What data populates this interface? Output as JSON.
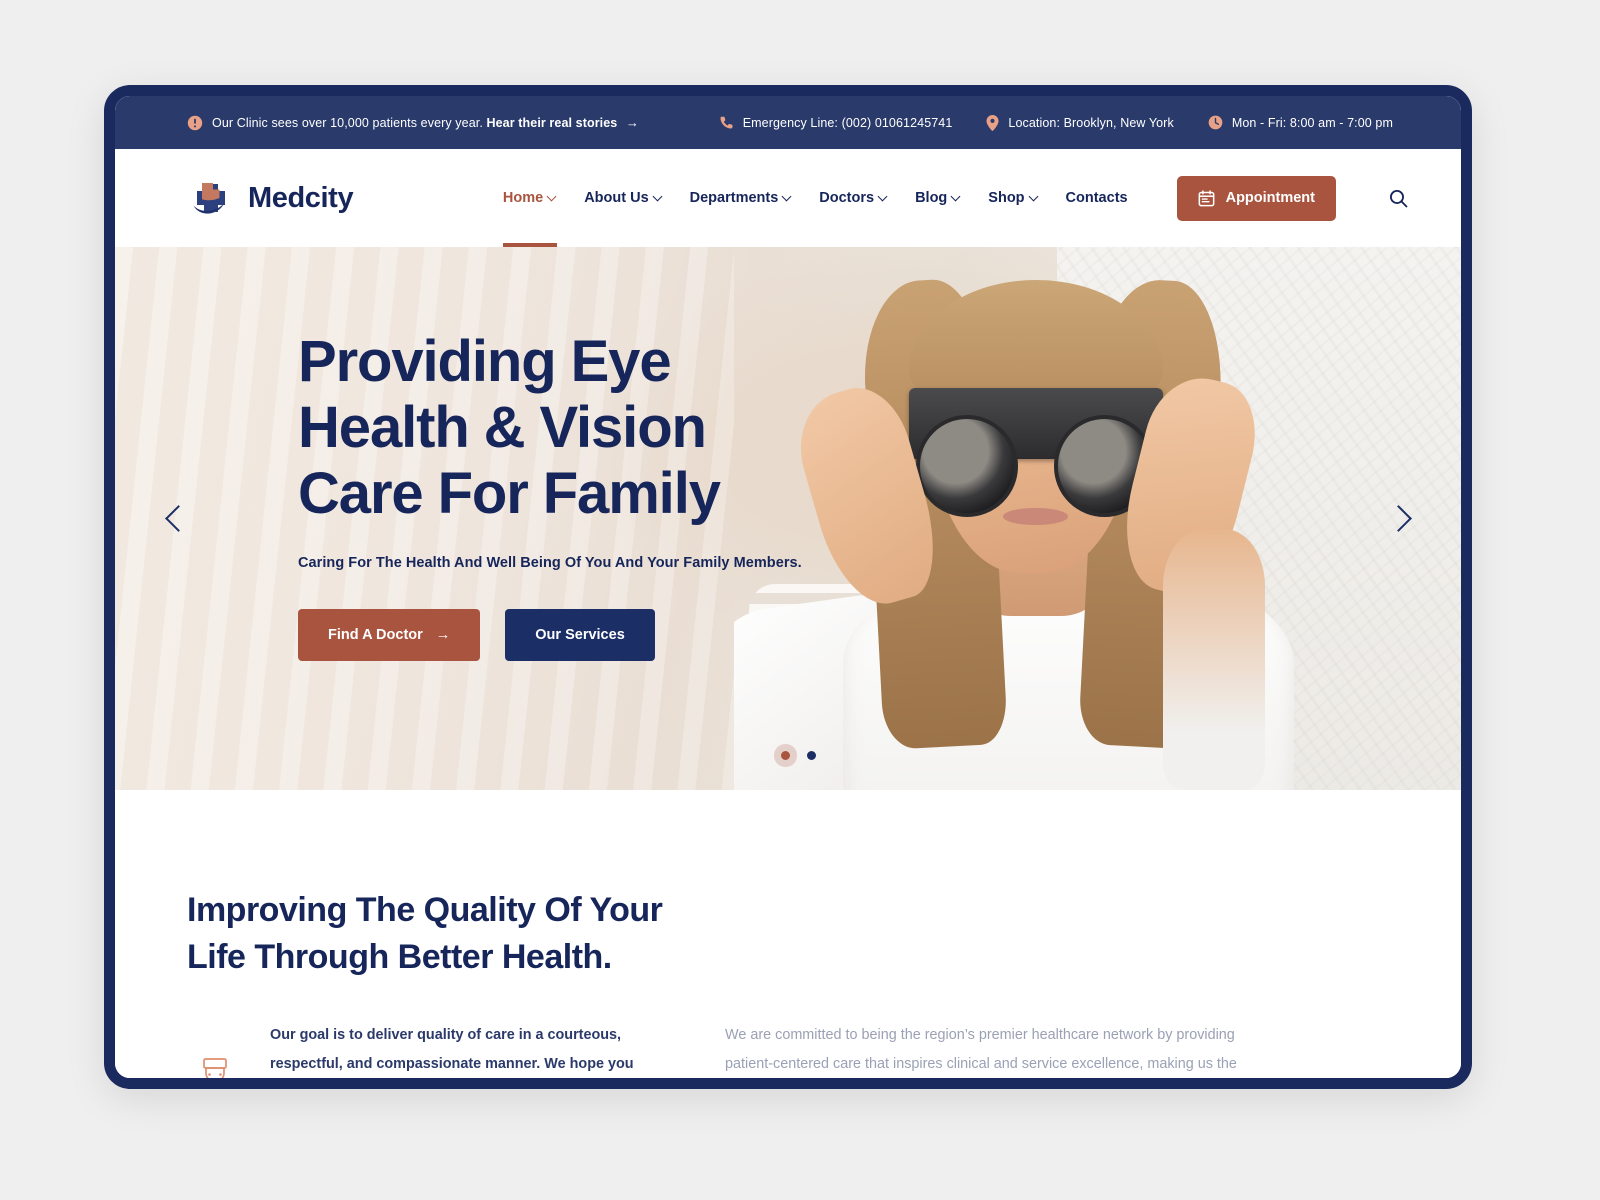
{
  "topbar": {
    "alert_icon": "exclamation-circle-icon",
    "notice_plain": "Our Clinic sees over 10,000 patients every year.",
    "notice_link": "Hear their real stories",
    "notice_arrow": "→",
    "items": [
      {
        "icon": "phone-icon",
        "label": "Emergency Line: (002) 01061245741"
      },
      {
        "icon": "map-pin-icon",
        "label": "Location: Brooklyn, New York"
      },
      {
        "icon": "clock-icon",
        "label": "Mon - Fri: 8:00 am - 7:00 pm"
      }
    ]
  },
  "header": {
    "brand": "Medcity",
    "nav": [
      {
        "label": "Home",
        "has_caret": true,
        "active": true
      },
      {
        "label": "About Us",
        "has_caret": true,
        "active": false
      },
      {
        "label": "Departments",
        "has_caret": true,
        "active": false
      },
      {
        "label": "Doctors",
        "has_caret": true,
        "active": false
      },
      {
        "label": "Blog",
        "has_caret": true,
        "active": false
      },
      {
        "label": "Shop",
        "has_caret": true,
        "active": false
      },
      {
        "label": "Contacts",
        "has_caret": false,
        "active": false
      }
    ],
    "appointment_label": "Appointment",
    "appointment_icon": "calendar-icon",
    "search_icon": "search-icon"
  },
  "hero": {
    "title_line1": "Providing Eye",
    "title_line2": "Health & Vision",
    "title_line3": "Care For Family",
    "subtitle": "Caring For The Health And Well Being Of You And Your Family Members.",
    "primary_btn": "Find A Doctor",
    "primary_btn_arrow": "→",
    "secondary_btn": "Our Services",
    "prev_label": "Previous slide",
    "next_label": "Next slide",
    "slide_count": 2,
    "active_slide": 1
  },
  "about": {
    "title_line1": "Improving The Quality Of Your",
    "title_line2": "Life Through Better Health.",
    "icon": "doctor-icon",
    "left_text": "Our goal is to deliver quality of care in a courteous, respectful, and compassionate manner. We hope you will allow us to care for you and strive to be the first and best choice for healthcare.",
    "right_text": "We are committed to being the region’s premier healthcare network by providing patient-centered care that inspires clinical and service excellence, making us the first and best choice for our patients, employees, physicians, employers, volunteers and communities. We serve the community by improving the quality"
  },
  "colors": {
    "navy": "#16255a",
    "navy_bar": "#2a3a6b",
    "rust": "#a9543f",
    "salmon": "#e8a187",
    "muted_text": "#9aa1b5",
    "page_bg": "#efefef"
  }
}
